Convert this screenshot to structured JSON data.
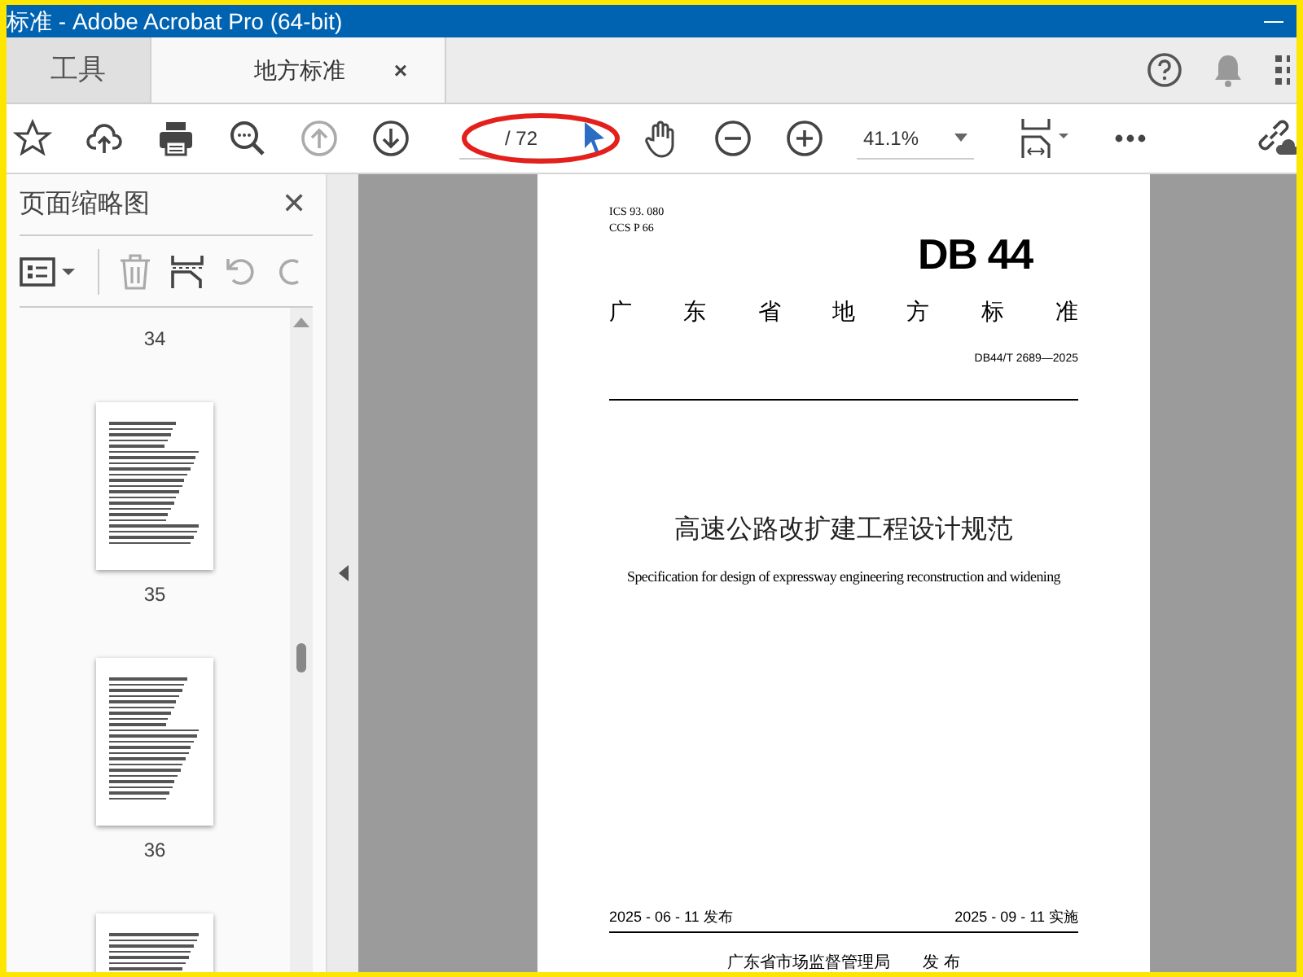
{
  "window": {
    "title": "标准 - Adobe Acrobat Pro (64-bit)"
  },
  "tabs": [
    {
      "label": "工具",
      "selected": false
    },
    {
      "label": "地方标准",
      "selected": true,
      "close": "×"
    }
  ],
  "toolbar": {
    "page_total": "/ 72",
    "zoom": "41.1%"
  },
  "sidebar": {
    "title": "页面缩略图",
    "close": "✕",
    "thumbnails": [
      {
        "thumbnail": false,
        "label": "34"
      },
      {
        "thumbnail": true,
        "label": "35"
      },
      {
        "thumbnail": true,
        "label": "36"
      },
      {
        "thumbnail": true
      }
    ]
  },
  "document": {
    "ics": "ICS  93. 080",
    "ccs": "CCS  P  66",
    "logo": "DB 44",
    "authority": "广东省地方标准",
    "number": "DB44/T  2689—2025",
    "title": "高速公路改扩建工程设计规范",
    "subtitle": "Specification for design of expressway engineering reconstruction and widening",
    "issued": "2025 - 06 - 11 发布",
    "effective": "2025 - 09 - 11 实施",
    "publisher": "广东省市场监督管理局　　发 布"
  }
}
